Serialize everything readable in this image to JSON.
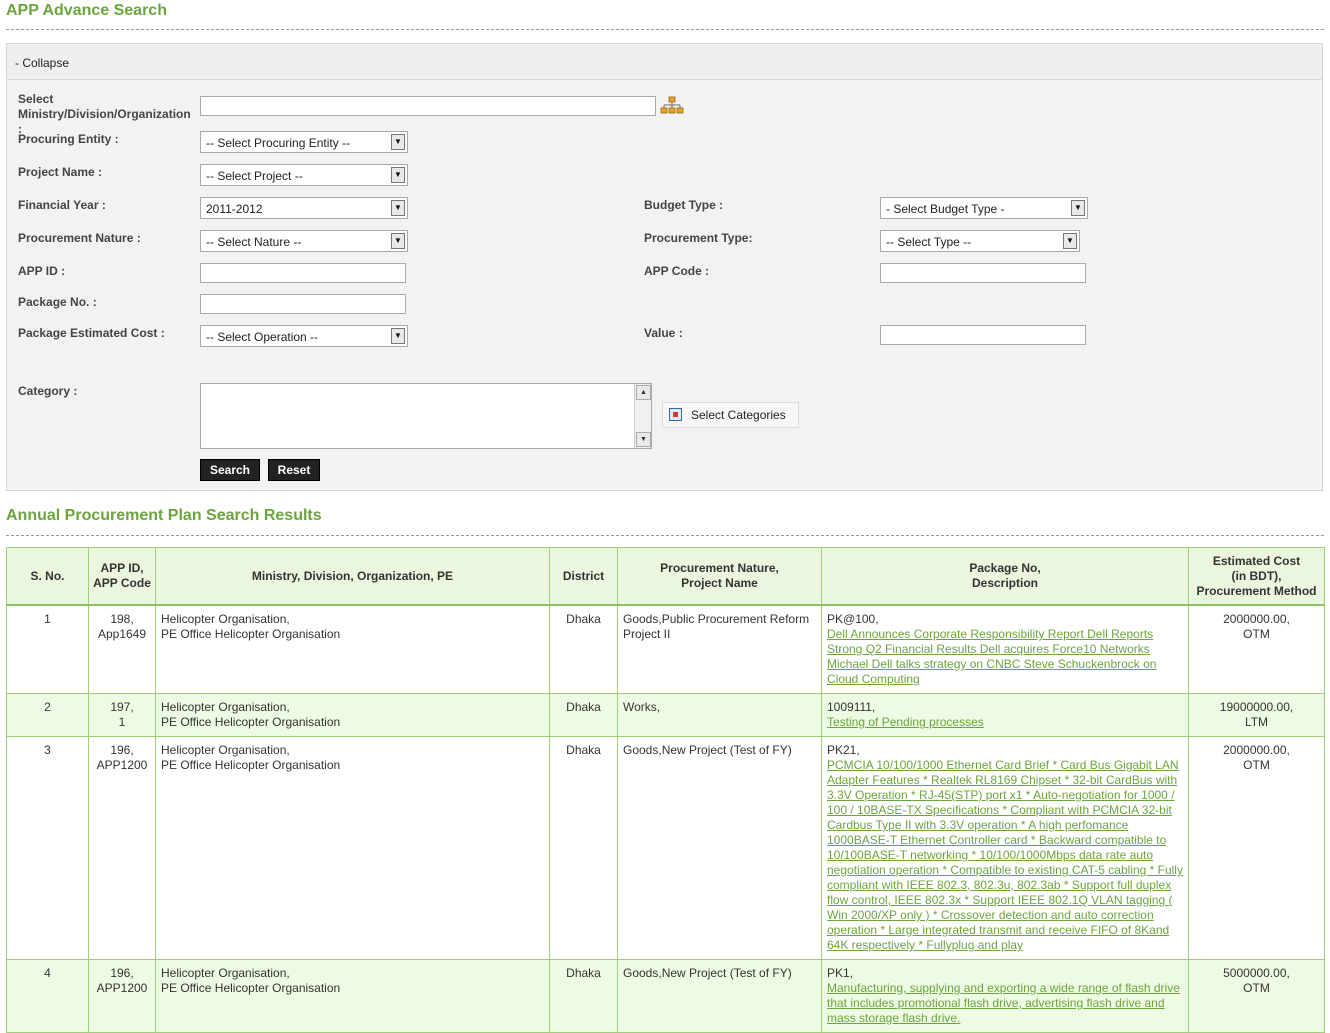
{
  "header": {
    "title": "APP Advance Search"
  },
  "search_panel": {
    "collapse_label": "- Collapse",
    "ministry_label": "Select Ministry/Division/Organization :",
    "ministry_value": "",
    "procuring_entity_label": "Procuring Entity :",
    "procuring_entity_value": "-- Select Procuring Entity --",
    "project_name_label": "Project Name :",
    "project_name_value": "-- Select Project --",
    "financial_year_label": "Financial Year :",
    "financial_year_value": "2011-2012",
    "budget_type_label": "Budget Type :",
    "budget_type_value": "- Select Budget Type -",
    "procurement_nature_label": "Procurement Nature :",
    "procurement_nature_value": "-- Select Nature --",
    "procurement_type_label": "Procurement Type:",
    "procurement_type_value": "-- Select Type --",
    "app_id_label": "APP ID :",
    "app_id_value": "",
    "app_code_label": "APP Code :",
    "app_code_value": "",
    "package_no_label": "Package No. :",
    "package_no_value": "",
    "package_cost_label": "Package Estimated Cost :",
    "package_cost_value": "-- Select Operation --",
    "value_label": "Value :",
    "value_value": "",
    "category_label": "Category :",
    "select_categories_label": "Select Categories",
    "search_button": "Search",
    "reset_button": "Reset"
  },
  "results": {
    "title": "Annual Procurement Plan Search Results",
    "columns": [
      "S. No.",
      "APP ID,\nAPP Code",
      "Ministry, Division, Organization, PE",
      "District",
      "Procurement Nature,\nProject Name",
      "Package No,\nDescription",
      "Estimated Cost\n(in BDT),\nProcurement Method"
    ],
    "rows": [
      {
        "sno": "1",
        "app": "198,\nApp1649",
        "org": "Helicopter Organisation,\nPE Office Helicopter Organisation",
        "district": "Dhaka",
        "nature": "Goods,Public Procurement Reform Project II",
        "package_no": "PK@100,",
        "description": "Dell Announces Corporate Responsibility Report Dell Reports Strong Q2 Financial Results Dell acquires Force10 Networks Michael Dell talks strategy on CNBC Steve Schuckenbrock on Cloud Computing",
        "cost": "2000000.00,\nOTM"
      },
      {
        "sno": "2",
        "app": "197,\n1",
        "org": "Helicopter Organisation,\nPE Office Helicopter Organisation",
        "district": "Dhaka",
        "nature": "Works,",
        "package_no": "1009111,",
        "description": "Testing of Pending processes",
        "cost": "19000000.00,\nLTM"
      },
      {
        "sno": "3",
        "app": "196,\nAPP1200",
        "org": "Helicopter Organisation,\nPE Office Helicopter Organisation",
        "district": "Dhaka",
        "nature": "Goods,New Project (Test of FY)",
        "package_no": "PK21,",
        "description": "PCMCIA 10/100/1000 Ethernet Card Brief * Card Bus Gigabit LAN Adapter Features * Realtek RL8169 Chipset * 32-bit CardBus with 3.3V Operation * RJ-45(STP) port x1 * Auto-negotiation for 1000 / 100 / 10BASE-TX Specifications * Compliant with PCMCIA 32-bit Cardbus Type II with 3.3V operation * A high perfomance 1000BASE-T Ethernet Controller card * Backward compatible to 10/100BASE-T networking * 10/100/1000Mbps data rate auto negotiation operation * Compatible to existing CAT-5 cabling * Fully compliant with IEEE 802.3, 802.3u, 802.3ab * Support full duplex flow control, IEEE 802.3x * Support IEEE 802.1Q VLAN tagging ( Win 2000/XP only ) * Crossover detection and auto correction operation * Large integrated transmit and receive FIFO of 8Kand 64K respectively * Fullyplug and play",
        "cost": "2000000.00,\nOTM"
      },
      {
        "sno": "4",
        "app": "196,\nAPP1200",
        "org": "Helicopter Organisation,\nPE Office Helicopter Organisation",
        "district": "Dhaka",
        "nature": "Goods,New Project (Test of FY)",
        "package_no": "PK1,",
        "description": "Manufacturing, supplying and exporting a wide range of flash drive that includes promotional flash drive, advertising flash drive and mass storage flash drive.",
        "cost": "5000000.00,\nOTM"
      }
    ]
  }
}
